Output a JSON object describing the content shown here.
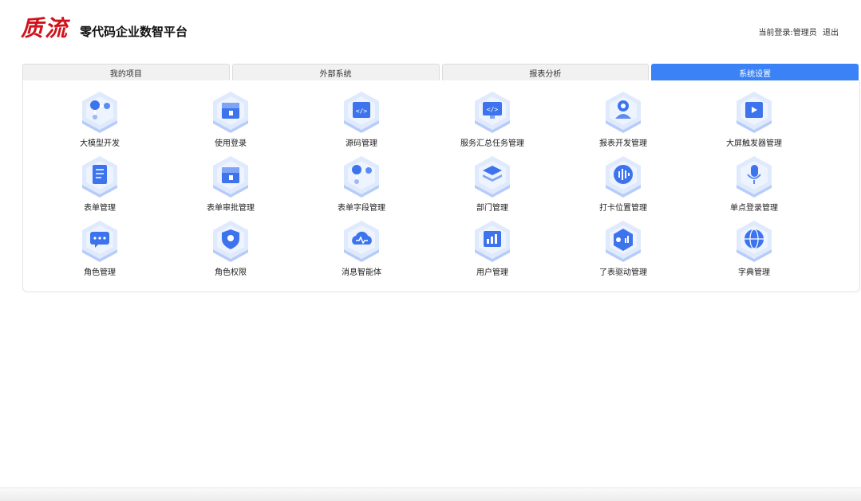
{
  "header": {
    "logo_text": "质流",
    "app_title": "零代码企业数智平台",
    "current_user": "当前登录:管理员",
    "logout_label": "退出"
  },
  "tabs": [
    {
      "label": "我的项目",
      "active": false
    },
    {
      "label": "外部系统",
      "active": false
    },
    {
      "label": "报表分析",
      "active": false
    },
    {
      "label": "系统设置",
      "active": true
    }
  ],
  "colors": {
    "accent": "#3b82f6",
    "logo": "#d0121b",
    "icon_light": "#dbe6fd",
    "icon_mid": "#9bb8f8",
    "icon_dark": "#3d74ee"
  },
  "modules": [
    {
      "label": "大模型开发",
      "icon": "molecule-icon"
    },
    {
      "label": "使用登录",
      "icon": "storage-box-icon"
    },
    {
      "label": "源码管理",
      "icon": "code-window-icon"
    },
    {
      "label": "服务汇总任务管理",
      "icon": "code-monitor-icon"
    },
    {
      "label": "报表开发管理",
      "icon": "user-gear-icon"
    },
    {
      "label": "大屏触发器管理",
      "icon": "screen-trigger-icon"
    },
    {
      "label": "表单管理",
      "icon": "form-icon"
    },
    {
      "label": "表单审批管理",
      "icon": "storage-box-icon"
    },
    {
      "label": "表单字段管理",
      "icon": "molecule-icon"
    },
    {
      "label": "部门管理",
      "icon": "layers-icon"
    },
    {
      "label": "打卡位置管理",
      "icon": "sound-wave-icon"
    },
    {
      "label": "单点登录管理",
      "icon": "microphone-icon"
    },
    {
      "label": "角色管理",
      "icon": "chat-screen-icon"
    },
    {
      "label": "角色权限",
      "icon": "shield-icon"
    },
    {
      "label": "消息智能体",
      "icon": "cloud-pulse-icon"
    },
    {
      "label": "用户管理",
      "icon": "user-chart-icon"
    },
    {
      "label": "了表驱动管理",
      "icon": "data-cube-icon"
    },
    {
      "label": "字典管理",
      "icon": "globe-icon"
    }
  ]
}
